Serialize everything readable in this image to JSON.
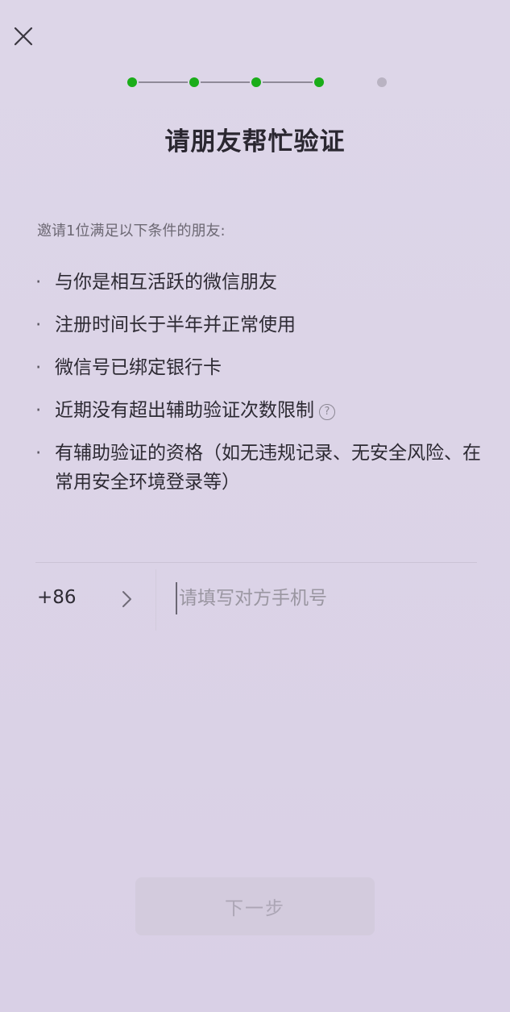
{
  "header": {
    "close_icon": "close-icon"
  },
  "progress": {
    "total_steps": 5,
    "completed_steps": 4,
    "active_color": "#1aad19",
    "inactive_color": "#b9b3c2"
  },
  "title": "请朋友帮忙验证",
  "intro": "邀请1位满足以下条件的朋友:",
  "conditions": [
    "与你是相互活跃的微信朋友",
    "注册时间长于半年并正常使用",
    "微信号已绑定银行卡",
    "近期没有超出辅助验证次数限制",
    "有辅助验证的资格（如无违规记录、无安全风险、在常用安全环境登录等）"
  ],
  "bullet": "·",
  "help_icon_glyph": "?",
  "phone": {
    "country_code": "+86",
    "placeholder": "请填写对方手机号",
    "value": ""
  },
  "next_button_label": "下一步"
}
